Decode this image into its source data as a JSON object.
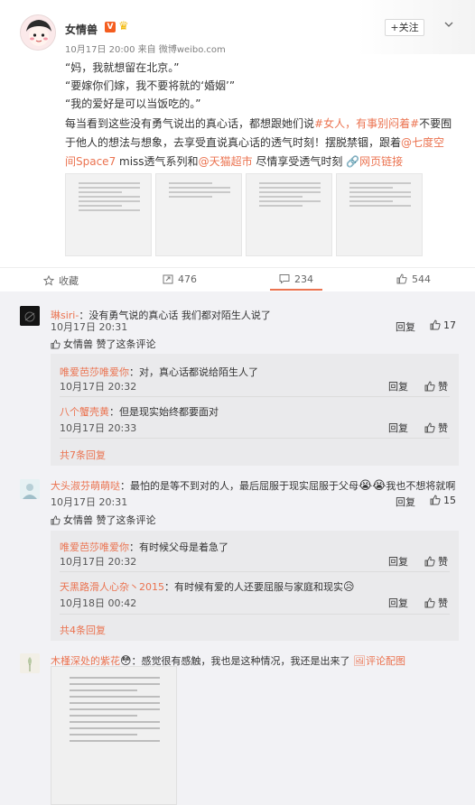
{
  "post": {
    "author": "女情兽",
    "vip_badge": "V",
    "time": "10月17日 20:00",
    "source_prefix": "来自",
    "source": "微博weibo.com",
    "follow_label": "+关注",
    "lines": [
      "“妈，我就想留在北京。”",
      "“要嫁你们嫁，我不要将就的‘婚姻’”",
      "“我的爱好是可以当饭吃的。”"
    ],
    "para1_a": "每当看到这些没有勇气说出的真心话，都想跟她们说",
    "para1_tag": "#女人，有事别闷着#",
    "para1_b": "不要囿",
    "para2_a": "于他人的想法与想象，去享受直说真心话的透气时刻！摆脱禁锢，跟着",
    "para2_mention": "@七度空",
    "para3_mention": "间Space7",
    "para3_a": " miss透气系列和",
    "para3_mention2": "@天猫超市",
    "para3_b": " 尽情享受透气时刻 ",
    "para3_link": "网页链接",
    "actions": {
      "collect": "收藏",
      "repost": "476",
      "comment": "234",
      "like": "544"
    },
    "colors": {
      "accent": "#eb7350",
      "comments_bg": "#f2f2f5"
    }
  },
  "comments": [
    {
      "user": "琳siri-",
      "text": "：没有勇气说的真心话 我们都对陌生人说了",
      "time": "10月17日 20:31",
      "reply": "回复",
      "likes": "17",
      "liked_by": "女情兽 赞了这条评论",
      "subs": [
        {
          "user": "唯爱芭莎唯爱你",
          "text": "：对，真心话都说给陌生人了",
          "time": "10月17日 20:32",
          "reply": "回复",
          "like": "赞"
        },
        {
          "user": "八个蟹壳黄",
          "text": "：但是现实始终都要面对",
          "time": "10月17日 20:33",
          "reply": "回复",
          "like": "赞"
        }
      ],
      "more": "共7条回复"
    },
    {
      "user": "大头淑芬萌萌哒",
      "text_a": "：最怕的是等不到对的人，最后屈服于现实屈服于父母",
      "text_b": "我也不想将就啊",
      "time": "10月17日 20:31",
      "reply": "回复",
      "likes": "15",
      "liked_by": "女情兽 赞了这条评论",
      "subs": [
        {
          "user": "唯爱芭莎唯爱你",
          "text": "：有时候父母是着急了",
          "time": "10月17日 20:32",
          "reply": "回复",
          "like": "赞"
        },
        {
          "user": "天黑路滑人心杂丶2015",
          "text": "：有时候有爱的人还要屈服与家庭和现实",
          "time": "10月18日 00:42",
          "reply": "回复",
          "like": "赞"
        }
      ],
      "more": "共4条回复"
    },
    {
      "user": "木槿深处的紫花",
      "text": "：感觉很有感触，我也是这种情况，我还是出来了",
      "image_link": "评论配图"
    }
  ]
}
